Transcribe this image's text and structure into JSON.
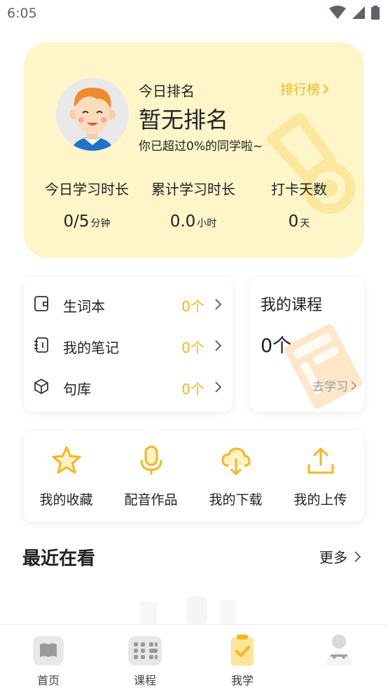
{
  "status_bar": {
    "time": "6:05"
  },
  "rank_card": {
    "label": "今日排名",
    "value": "暂无排名",
    "subtitle": "你已超过0%的同学啦~",
    "leaderboard_link": "排行榜",
    "stats": [
      {
        "label": "今日学习时长",
        "value": "0/5",
        "unit": "分钟"
      },
      {
        "label": "累计学习时长",
        "value": "0.0",
        "unit": "小时"
      },
      {
        "label": "打卡天数",
        "value": "0",
        "unit": "天"
      }
    ]
  },
  "list_card": {
    "rows": [
      {
        "label": "生词本",
        "count": "0个",
        "icon": "wordbook-icon"
      },
      {
        "label": "我的笔记",
        "count": "0个",
        "icon": "notebook-icon"
      },
      {
        "label": "句库",
        "count": "0个",
        "icon": "box-icon"
      }
    ]
  },
  "course_card": {
    "title": "我的课程",
    "count": "0个",
    "go_label": "去学习"
  },
  "actions": [
    {
      "label": "我的收藏",
      "icon": "star-icon"
    },
    {
      "label": "配音作品",
      "icon": "microphone-icon"
    },
    {
      "label": "我的下载",
      "icon": "cloud-download-icon"
    },
    {
      "label": "我的上传",
      "icon": "upload-icon"
    }
  ],
  "recent": {
    "title": "最近在看",
    "more_label": "更多"
  },
  "bottom_nav": {
    "items": [
      {
        "label": "首页",
        "icon": "home-book-icon",
        "active": false
      },
      {
        "label": "课程",
        "icon": "course-grid-icon",
        "active": false
      },
      {
        "label": "我学",
        "icon": "clipboard-check-icon",
        "active": true
      },
      {
        "label": "",
        "icon": "profile-icon",
        "active": false
      }
    ]
  },
  "colors": {
    "accent": "#f5b621",
    "card_bg": "#fef6c9",
    "text": "#222222",
    "muted": "#999999"
  }
}
